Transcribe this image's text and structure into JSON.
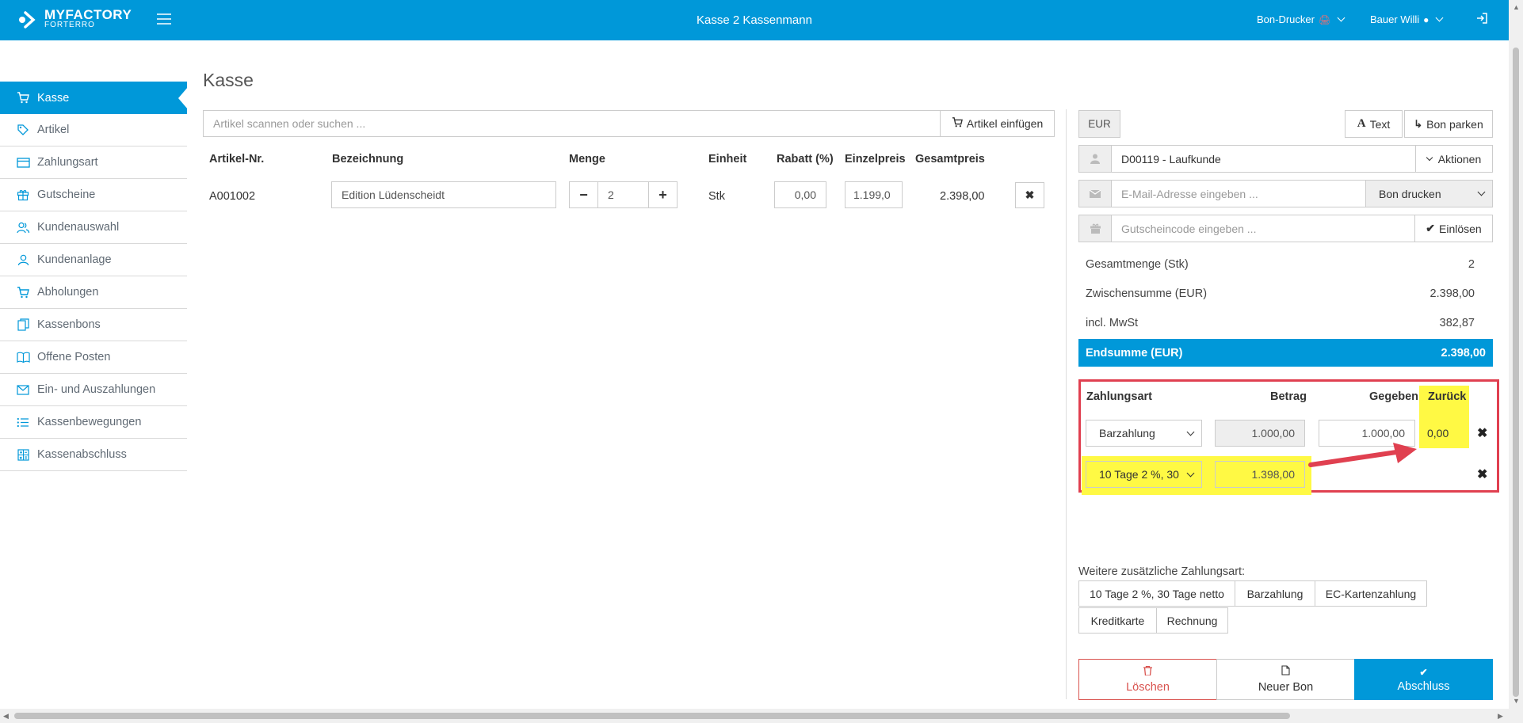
{
  "brand": {
    "name": "MYFACTORY",
    "sub": "FORTERRO"
  },
  "header": {
    "title": "Kasse 2 Kassenmann",
    "printer": "Bon-Drucker",
    "user": "Bauer Willi"
  },
  "sidebar": {
    "items": [
      {
        "label": "Kasse",
        "icon": "cart-icon",
        "active": true
      },
      {
        "label": "Artikel",
        "icon": "tag-icon"
      },
      {
        "label": "Zahlungsart",
        "icon": "credit-card-icon"
      },
      {
        "label": "Gutscheine",
        "icon": "gift-icon"
      },
      {
        "label": "Kundenauswahl",
        "icon": "users-icon"
      },
      {
        "label": "Kundenanlage",
        "icon": "user-icon"
      },
      {
        "label": "Abholungen",
        "icon": "basket-icon"
      },
      {
        "label": "Kassenbons",
        "icon": "copy-icon"
      },
      {
        "label": "Offene Posten",
        "icon": "book-icon"
      },
      {
        "label": "Ein- und Auszahlungen",
        "icon": "envelope-icon"
      },
      {
        "label": "Kassenbewegungen",
        "icon": "list-icon"
      },
      {
        "label": "Kassenabschluss",
        "icon": "calculator-icon"
      }
    ]
  },
  "main": {
    "title": "Kasse",
    "search_placeholder": "Artikel scannen oder suchen ...",
    "insert_label": "Artikel einfügen",
    "columns": [
      "Artikel-Nr.",
      "Bezeichnung",
      "Menge",
      "Einheit",
      "Rabatt (%)",
      "Einzelpreis",
      "Gesamtpreis"
    ],
    "row": {
      "nr": "A001002",
      "bezeichnung": "Edition Lüdenscheidt",
      "menge": "2",
      "einheit": "Stk",
      "rabatt": "0,00",
      "einzelpreis": "1.199,0",
      "gesamtpreis": "2.398,00"
    }
  },
  "panel": {
    "currency": "EUR",
    "text_label": "Text",
    "park_label": "Bon parken",
    "customer": "D00119 - Laufkunde",
    "actions_label": "Aktionen",
    "email_placeholder": "E-Mail-Adresse eingeben ...",
    "print_option": "Bon drucken",
    "voucher_placeholder": "Gutscheincode eingeben ...",
    "redeem_label": "Einlösen",
    "totals": [
      {
        "label": "Gesamtmenge (Stk)",
        "value": "2"
      },
      {
        "label": "Zwischensumme (EUR)",
        "value": "2.398,00"
      },
      {
        "label": "incl. MwSt",
        "value": "382,87"
      }
    ],
    "grand_total": {
      "label": "Endsumme (EUR)",
      "value": "2.398,00"
    },
    "payment_headers": {
      "type": "Zahlungsart",
      "amount": "Betrag",
      "given": "Gegeben",
      "change": "Zurück"
    },
    "payments": [
      {
        "type": "Barzahlung",
        "amount": "1.000,00",
        "given": "1.000,00",
        "change": "0,00"
      },
      {
        "type": "10 Tage 2 %, 30",
        "amount": "1.398,00"
      }
    ],
    "extra_label": "Weitere zusätzliche Zahlungsart:",
    "extra_options": [
      "10 Tage 2 %, 30 Tage netto",
      "Barzahlung",
      "EC-Kartenzahlung",
      "Kreditkarte",
      "Rechnung"
    ],
    "delete_label": "Löschen",
    "new_label": "Neuer Bon",
    "finish_label": "Abschluss"
  },
  "colors": {
    "accent": "#0098d9",
    "highlight": "#fff944",
    "annotation": "#e04050",
    "danger": "#d9534f"
  }
}
